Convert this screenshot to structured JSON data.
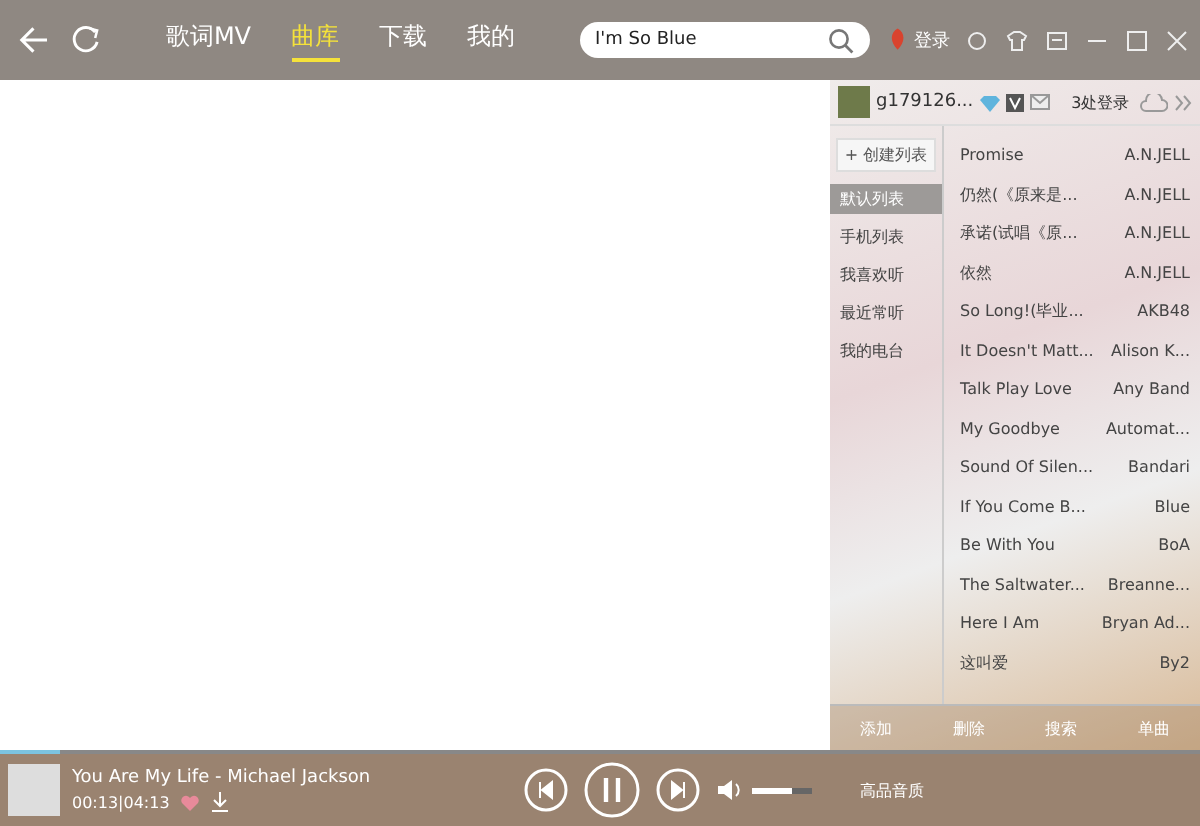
{
  "nav": {
    "tabs": [
      {
        "label": "歌词MV",
        "selected": false
      },
      {
        "label": "曲库",
        "selected": true
      },
      {
        "label": "下载",
        "selected": false
      },
      {
        "label": "我的",
        "selected": false
      }
    ],
    "search": {
      "value": "I'm So Blue"
    },
    "login": "登录"
  },
  "account": {
    "user": "g179126...",
    "logins": "3处登录"
  },
  "sidebar": {
    "create": "+ 创建列表",
    "items": [
      {
        "label": "默认列表",
        "selected": true
      },
      {
        "label": "手机列表",
        "selected": false
      },
      {
        "label": "我喜欢听",
        "selected": false
      },
      {
        "label": "最近常听",
        "selected": false
      },
      {
        "label": "我的电台",
        "selected": false
      }
    ]
  },
  "songs": [
    {
      "title": "Promise",
      "artist": "A.N.JELL"
    },
    {
      "title": "仍然(《原来是...",
      "artist": "A.N.JELL"
    },
    {
      "title": "承诺(试唱《原...",
      "artist": "A.N.JELL"
    },
    {
      "title": "依然",
      "artist": "A.N.JELL"
    },
    {
      "title": "So Long!(毕业...",
      "artist": "AKB48"
    },
    {
      "title": "It Doesn't Matt...",
      "artist": "Alison K..."
    },
    {
      "title": "Talk Play Love",
      "artist": "Any Band"
    },
    {
      "title": "My Goodbye",
      "artist": "Automat..."
    },
    {
      "title": "Sound Of Silen...",
      "artist": "Bandari"
    },
    {
      "title": "If You Come B...",
      "artist": "Blue"
    },
    {
      "title": "Be With You",
      "artist": "BoA"
    },
    {
      "title": "The Saltwater...",
      "artist": "Breanne..."
    },
    {
      "title": "Here I Am",
      "artist": "Bryan Ad..."
    },
    {
      "title": "这叫爱",
      "artist": "By2"
    }
  ],
  "list_actions": [
    "添加",
    "删除",
    "搜索",
    "单曲"
  ],
  "player": {
    "track": "You Are My Life - Michael Jackson",
    "time": "00:13|04:13",
    "progress": {
      "level": 0.05
    },
    "volume": {
      "level": 0.65
    },
    "quality": "高品音质"
  }
}
